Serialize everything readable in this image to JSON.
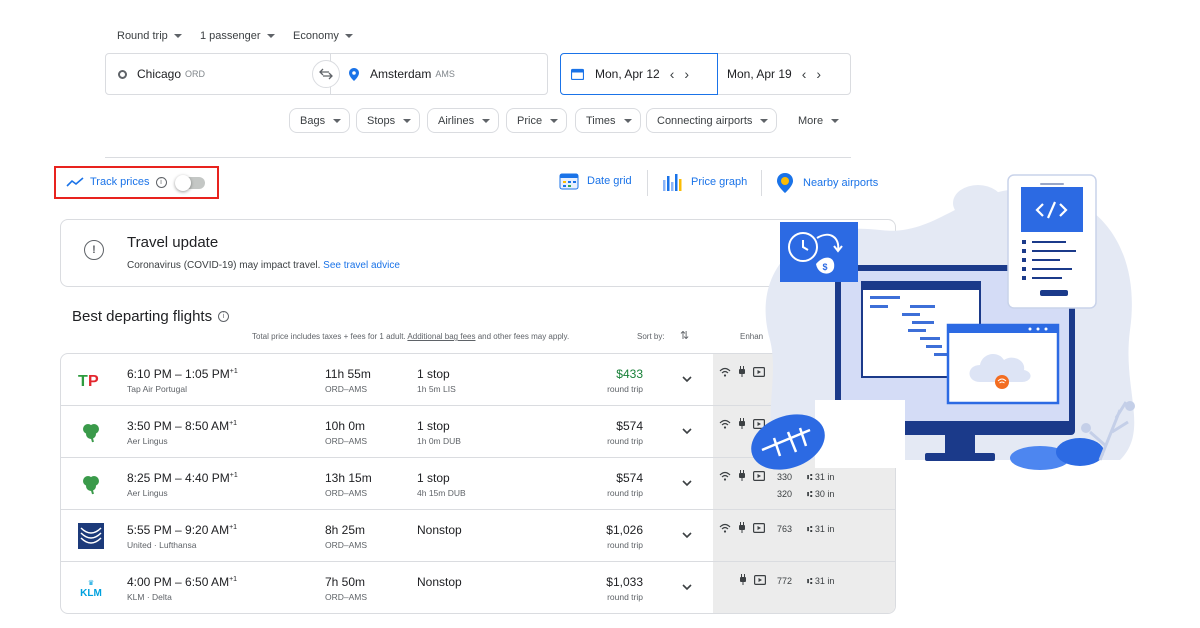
{
  "search": {
    "trip_type": "Round trip",
    "passengers": "1 passenger",
    "cabin": "Economy",
    "origin_city": "Chicago",
    "origin_code": "ORD",
    "destination_city": "Amsterdam",
    "destination_code": "AMS",
    "depart_date": "Mon, Apr 12",
    "return_date": "Mon, Apr 19"
  },
  "filters": [
    "Bags",
    "Stops",
    "Airlines",
    "Price",
    "Times",
    "Connecting airports",
    "More"
  ],
  "track": {
    "label": "Track prices",
    "enabled": false
  },
  "tools": {
    "date_grid": "Date grid",
    "price_graph": "Price graph",
    "nearby": "Nearby airports"
  },
  "update": {
    "title": "Travel update",
    "message": "Coronavirus (COVID-19) may impact travel.",
    "link": "See travel advice"
  },
  "results": {
    "heading": "Best departing flights",
    "note_prefix": "Total price includes taxes + fees for 1 adult.",
    "note_link": "Additional bag fees",
    "note_suffix": "and other fees may apply.",
    "sort_label": "Sort by:",
    "enhanced_label": "Enhan"
  },
  "flights": [
    {
      "times": "6:10 PM – 1:05 PM",
      "plus": "+1",
      "airline": "Tap Air Portugal",
      "duration": "11h 55m",
      "route": "ORD–AMS",
      "stops": "1 stop",
      "layover": "1h 5m LIS",
      "price": "$433",
      "price_type": "round trip",
      "logo": "tap-logo",
      "aircraft": "",
      "legroom": ""
    },
    {
      "times": "3:50 PM – 8:50 AM",
      "plus": "+1",
      "airline": "Aer Lingus",
      "duration": "10h 0m",
      "route": "ORD–AMS",
      "stops": "1 stop",
      "layover": "1h 0m DUB",
      "price": "$574",
      "price_type": "round trip",
      "logo": "shamrock-logo",
      "aircraft": "",
      "legroom": ""
    },
    {
      "times": "8:25 PM – 4:40 PM",
      "plus": "+1",
      "airline": "Aer Lingus",
      "duration": "13h 15m",
      "route": "ORD–AMS",
      "stops": "1 stop",
      "layover": "4h 15m DUB",
      "price": "$574",
      "price_type": "round trip",
      "logo": "shamrock-logo",
      "aircraft": "330",
      "legroom": "31 in",
      "aircraft2": "320",
      "legroom2": "30 in"
    },
    {
      "times": "5:55 PM – 9:20 AM",
      "plus": "+1",
      "airline": "United  ·  Lufthansa",
      "duration": "8h 25m",
      "route": "ORD–AMS",
      "stops": "Nonstop",
      "layover": "",
      "price": "$1,026",
      "price_type": "round trip",
      "logo": "united-logo",
      "aircraft": "763",
      "legroom": "31 in"
    },
    {
      "times": "4:00 PM – 6:50 AM",
      "plus": "+1",
      "airline": "KLM  ·  Delta",
      "duration": "7h 50m",
      "route": "ORD–AMS",
      "stops": "Nonstop",
      "layover": "",
      "price": "$1,033",
      "price_type": "round trip",
      "logo": "klm-logo",
      "aircraft": "772",
      "legroom": "31 in"
    }
  ],
  "colors": {
    "accent": "#1a73e8",
    "highlight_box": "#e8231e",
    "price_green": "#188038"
  }
}
